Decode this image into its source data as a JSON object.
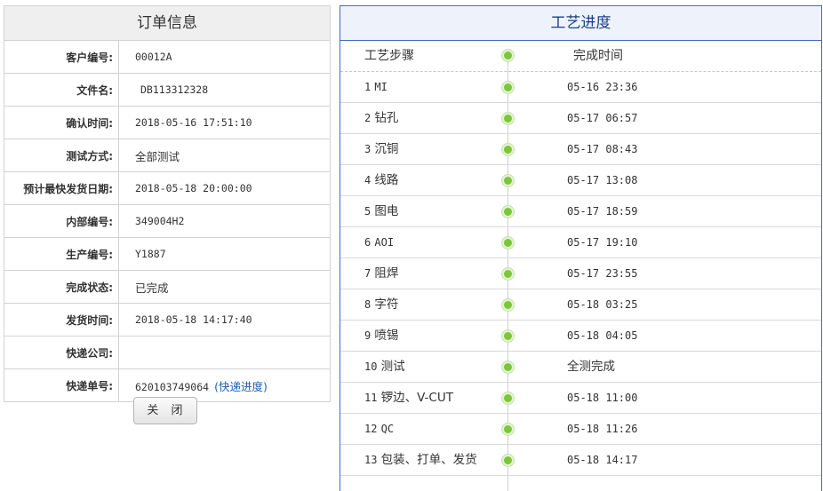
{
  "order_panel": {
    "title": "订单信息",
    "fields": [
      {
        "label": "客户编号:",
        "value": "00012A"
      },
      {
        "label": "文件名:",
        "value": "DB113312328"
      },
      {
        "label": "确认时间:",
        "value": "2018-05-16 17:51:10"
      },
      {
        "label": "测试方式:",
        "value": "全部测试"
      },
      {
        "label": "预计最快发货日期:",
        "value": "2018-05-18 20:00:00"
      },
      {
        "label": "内部编号:",
        "value": "349004H2"
      },
      {
        "label": "生产编号:",
        "value": "Y1887"
      },
      {
        "label": "完成状态:",
        "value": "已完成"
      },
      {
        "label": "发货时间:",
        "value": "2018-05-18 14:17:40"
      },
      {
        "label": "快递公司:",
        "value": ""
      },
      {
        "label": "快递单号:",
        "value": "620103749064",
        "link": "(快递进度)"
      }
    ],
    "close_button": "关 闭"
  },
  "process_panel": {
    "title": "工艺进度",
    "header": {
      "step": "工艺步骤",
      "time": "完成时间"
    },
    "steps": [
      {
        "num": "1",
        "name": "MI",
        "time": "05-16 23:36"
      },
      {
        "num": "2",
        "name": "钻孔",
        "time": "05-17 06:57"
      },
      {
        "num": "3",
        "name": "沉铜",
        "time": "05-17 08:43"
      },
      {
        "num": "4",
        "name": "线路",
        "time": "05-17 13:08"
      },
      {
        "num": "5",
        "name": "图电",
        "time": "05-17 18:59"
      },
      {
        "num": "6",
        "name": "AOI",
        "time": "05-17 19:10"
      },
      {
        "num": "7",
        "name": "阻焊",
        "time": "05-17 23:55"
      },
      {
        "num": "8",
        "name": "字符",
        "time": "05-18 03:25"
      },
      {
        "num": "9",
        "name": "喷锡",
        "time": "05-18 04:05"
      },
      {
        "num": "10",
        "name": "测试",
        "time": "全测完成"
      },
      {
        "num": "11",
        "name": "锣边、V-CUT",
        "time": "05-18 11:00"
      },
      {
        "num": "12",
        "name": "QC",
        "time": "05-18 11:26"
      },
      {
        "num": "13",
        "name": "包装、打单、发货",
        "time": "05-18 14:17"
      }
    ],
    "dot_color": "#7cc63a"
  }
}
